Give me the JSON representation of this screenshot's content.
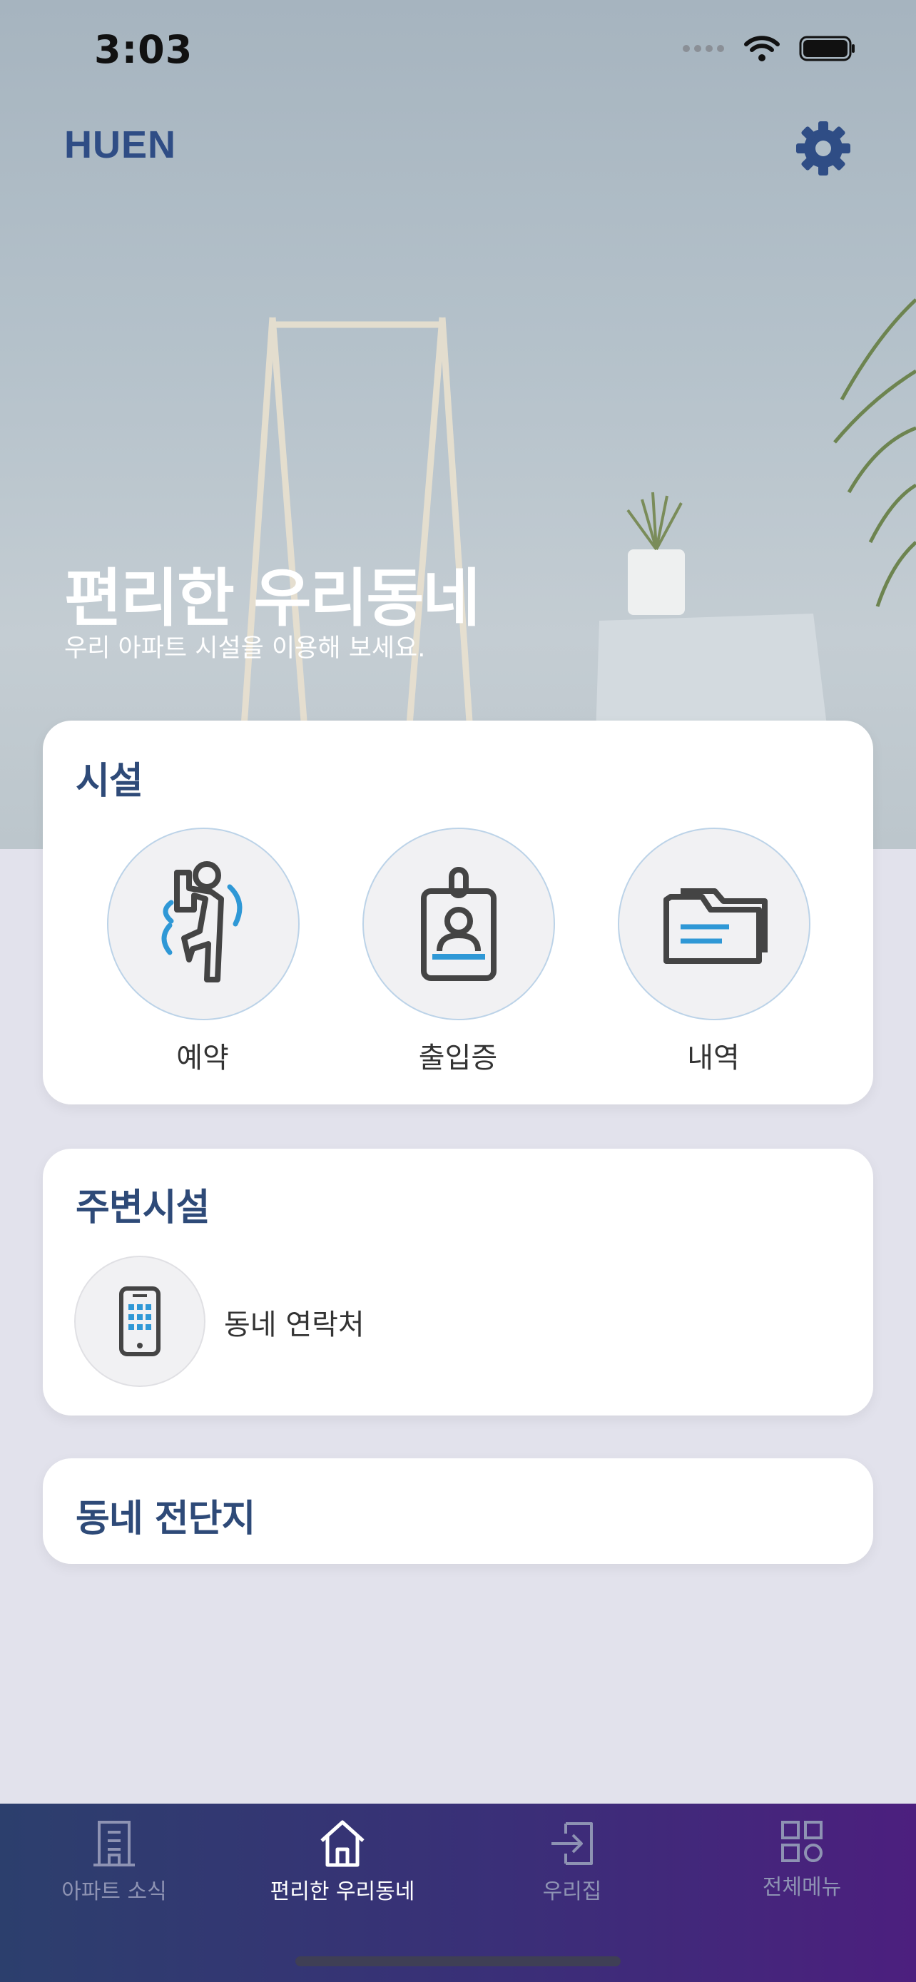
{
  "status": {
    "time": "3:03"
  },
  "header": {
    "logo": "HUEN",
    "settings_icon": "gear-icon"
  },
  "hero": {
    "title": "편리한 우리동네",
    "subtitle": "우리 아파트 시설을 이용해 보세요."
  },
  "facilities": {
    "title": "시설",
    "items": [
      {
        "label": "예약",
        "icon": "exercise-icon"
      },
      {
        "label": "출입증",
        "icon": "id-badge-icon"
      },
      {
        "label": "내역",
        "icon": "folder-icon"
      }
    ]
  },
  "nearby": {
    "title": "주변시설",
    "items": [
      {
        "label": "동네 연락처",
        "icon": "phone-keypad-icon"
      }
    ]
  },
  "flyers": {
    "title": "동네 전단지"
  },
  "tabbar": {
    "items": [
      {
        "label": "아파트 소식",
        "icon": "building-icon",
        "active": false
      },
      {
        "label": "편리한 우리동네",
        "icon": "home-icon",
        "active": true
      },
      {
        "label": "우리집",
        "icon": "enter-icon",
        "active": false
      },
      {
        "label": "전체메뉴",
        "icon": "grid-icon",
        "active": false
      }
    ]
  },
  "colors": {
    "brand": "#2f4d85",
    "accent_blue": "#2f98d6",
    "tabbar_start": "#2c3f6d",
    "tabbar_end": "#4c1f7e"
  }
}
